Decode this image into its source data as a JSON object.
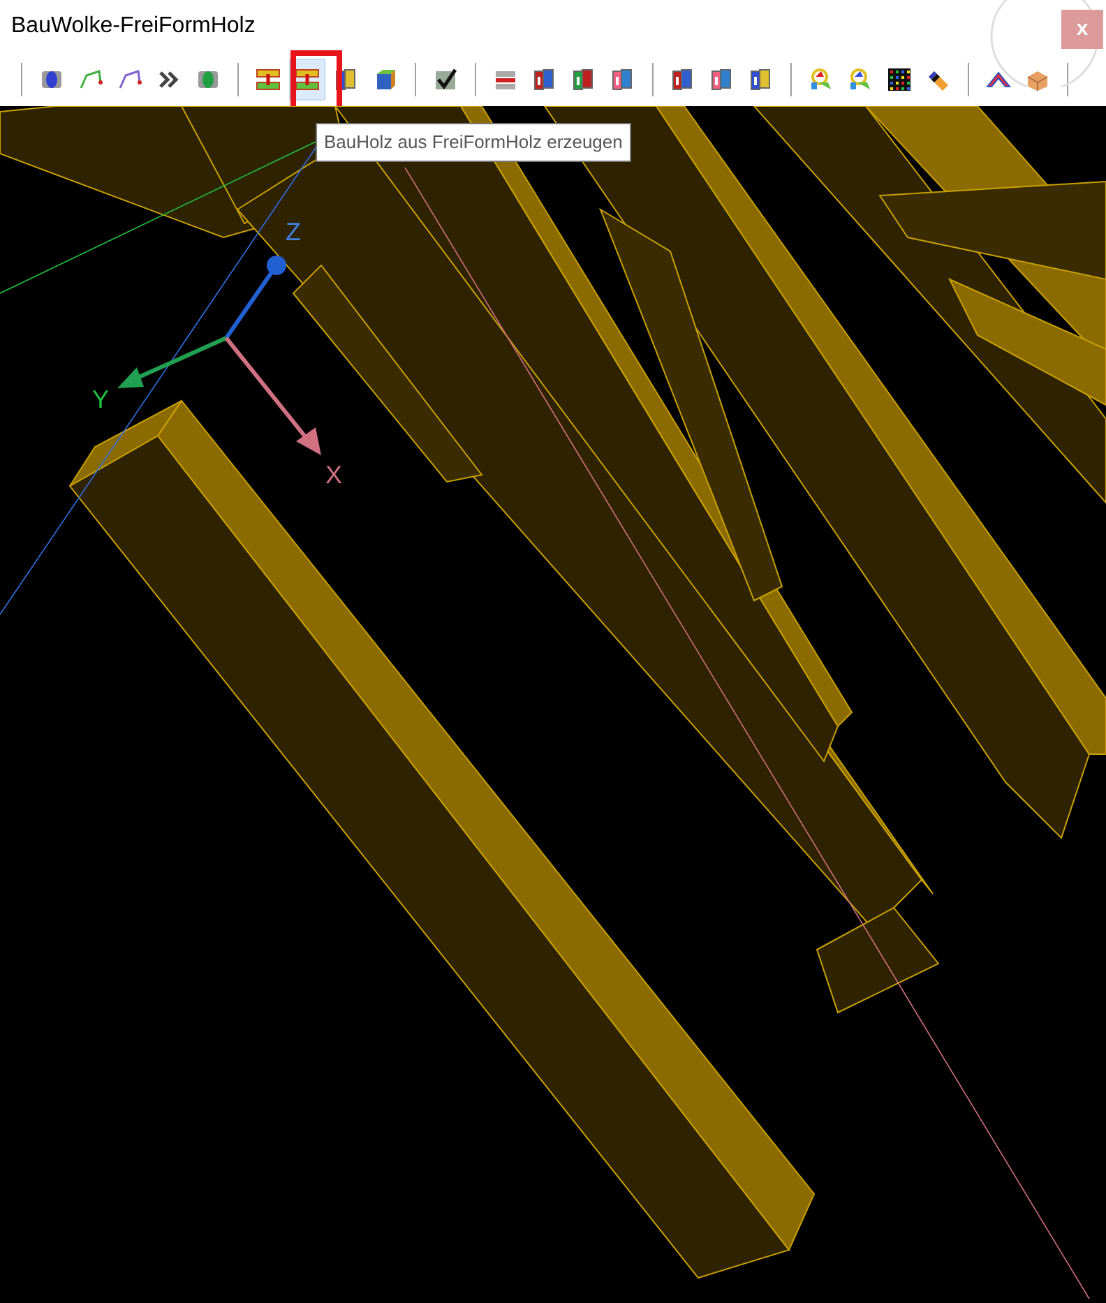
{
  "window": {
    "title": "BauWolke-FreiFormHolz",
    "close_button": "x"
  },
  "toolbar": {
    "groups": [
      [
        {
          "kind": "figure-blue",
          "selected": false
        },
        {
          "kind": "curve-green",
          "selected": false
        },
        {
          "kind": "curve-purple",
          "selected": false
        },
        {
          "kind": "chevrons",
          "selected": false
        },
        {
          "kind": "figure-green",
          "selected": false
        }
      ],
      [
        {
          "kind": "beam-split",
          "selected": false
        },
        {
          "kind": "beam-split",
          "selected": true
        },
        {
          "kind": "panels-blue",
          "selected": false
        },
        {
          "kind": "cube",
          "selected": false
        }
      ],
      [
        {
          "kind": "check",
          "selected": false
        }
      ],
      [
        {
          "kind": "beam-red",
          "selected": false
        },
        {
          "kind": "panels-red",
          "selected": false
        },
        {
          "kind": "panels-green",
          "selected": false
        },
        {
          "kind": "panels-pink",
          "selected": false
        }
      ],
      [
        {
          "kind": "panels-red",
          "selected": false
        },
        {
          "kind": "panels-pink",
          "selected": false
        },
        {
          "kind": "panels-blue",
          "selected": false
        }
      ],
      [
        {
          "kind": "paint-red",
          "selected": false
        },
        {
          "kind": "paint-blue",
          "selected": false
        },
        {
          "kind": "grid",
          "selected": false
        },
        {
          "kind": "pencil",
          "selected": false
        }
      ],
      [
        {
          "kind": "roof",
          "selected": false
        },
        {
          "kind": "box",
          "selected": false
        }
      ]
    ]
  },
  "tooltip": "BauHolz aus FreiFormHolz erzeugen",
  "viewport": {
    "axes": [
      {
        "kind": "x",
        "label": "X"
      },
      {
        "kind": "y",
        "label": "Y"
      },
      {
        "kind": "z",
        "label": "Z"
      }
    ]
  }
}
